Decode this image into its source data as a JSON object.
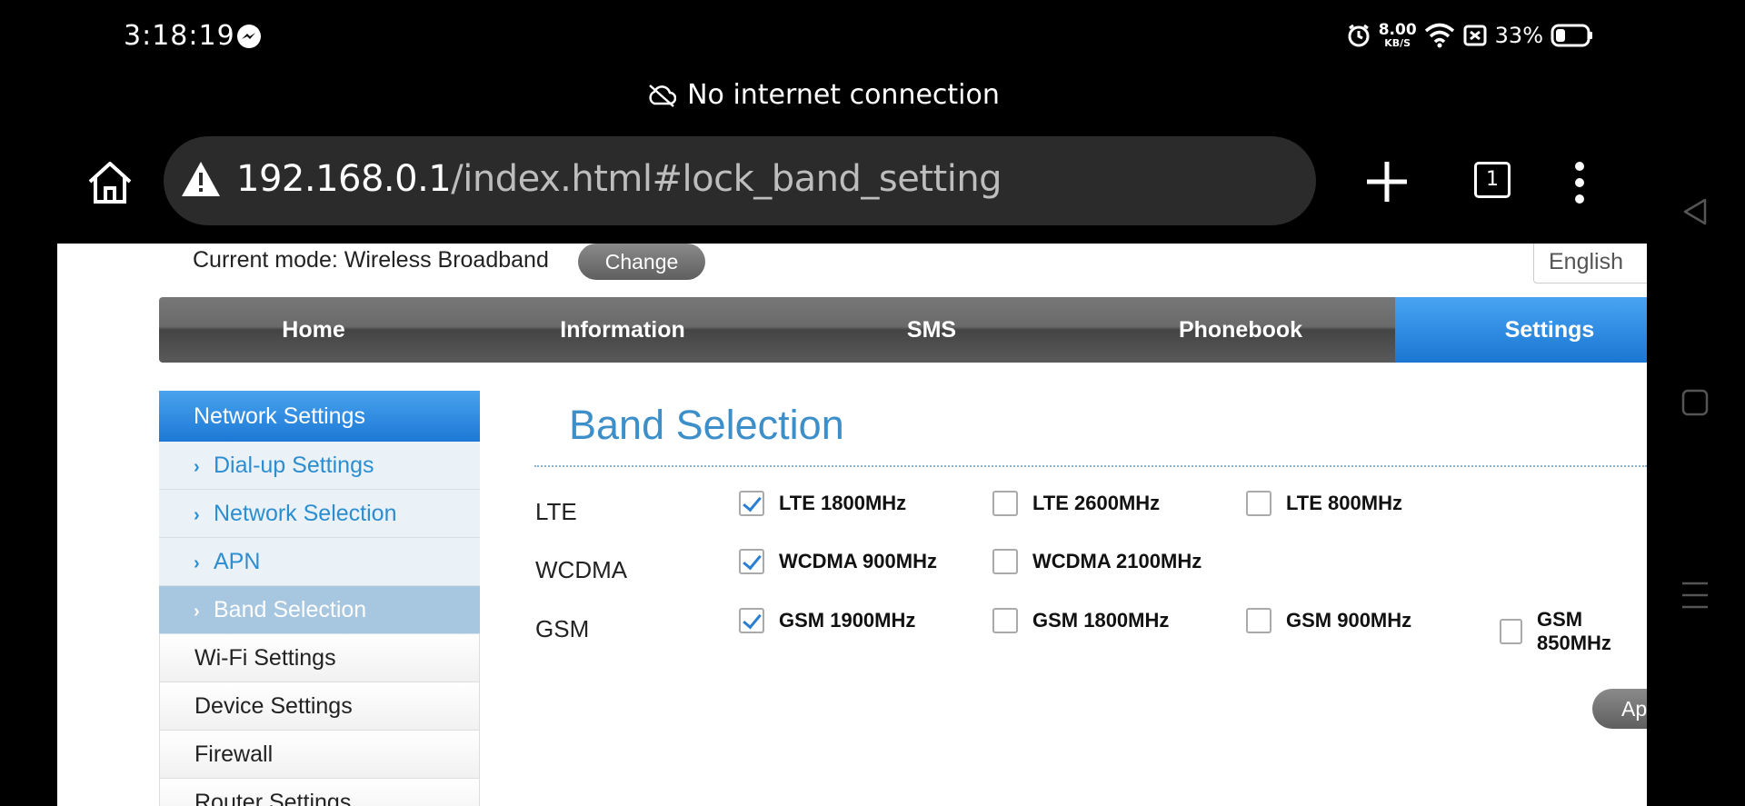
{
  "status_bar": {
    "time": "3:18:19",
    "net_speed_value": "8.00",
    "net_speed_unit": "KB/S",
    "battery_percent": "33%"
  },
  "offline_banner": {
    "text": "No internet connection"
  },
  "browser": {
    "url_host": "192.168.0.1",
    "url_path": "/index.html#lock_band_setting",
    "tab_count": "1"
  },
  "header": {
    "mode_text": "Current mode: Wireless Broadband",
    "change_label": "Change",
    "language": "English"
  },
  "main_nav": [
    {
      "label": "Home"
    },
    {
      "label": "Information"
    },
    {
      "label": "SMS"
    },
    {
      "label": "Phonebook"
    },
    {
      "label": "Settings",
      "active": true
    }
  ],
  "sidebar": {
    "section_title": "Network Settings",
    "sub_items": [
      {
        "label": "Dial-up Settings"
      },
      {
        "label": "Network Selection"
      },
      {
        "label": "APN"
      },
      {
        "label": "Band Selection",
        "active": true
      }
    ],
    "items": [
      {
        "label": "Wi-Fi Settings"
      },
      {
        "label": "Device Settings"
      },
      {
        "label": "Firewall"
      },
      {
        "label": "Router Settings"
      }
    ]
  },
  "band_selection": {
    "title": "Band Selection",
    "rows": [
      {
        "label": "LTE",
        "options": [
          {
            "label": "LTE 1800MHz",
            "checked": true
          },
          {
            "label": "LTE 2600MHz",
            "checked": false
          },
          {
            "label": "LTE 800MHz",
            "checked": false
          }
        ]
      },
      {
        "label": "WCDMA",
        "options": [
          {
            "label": "WCDMA 900MHz",
            "checked": true
          },
          {
            "label": "WCDMA 2100MHz",
            "checked": false
          }
        ]
      },
      {
        "label": "GSM",
        "options": [
          {
            "label": "GSM 1900MHz",
            "checked": true
          },
          {
            "label": "GSM 1800MHz",
            "checked": false
          },
          {
            "label": "GSM 900MHz",
            "checked": false
          },
          {
            "label": "GSM 850MHz",
            "checked": false
          }
        ]
      }
    ],
    "apply_label": "Apply"
  },
  "colors": {
    "accent_blue": "#1c78d6",
    "title_blue": "#3d8fc9",
    "link_blue": "#2c8ed0"
  }
}
